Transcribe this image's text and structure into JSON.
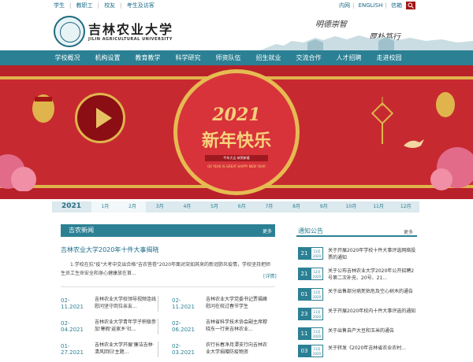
{
  "top": {
    "links": [
      "学生",
      "教职工",
      "校友",
      "考生及访客"
    ],
    "lang": [
      "内网",
      "ENGLISH",
      "信箱"
    ]
  },
  "header": {
    "name_cn": "吉林农业大学",
    "name_en": "JILIN AGRICULTURAL UNIVERSITY",
    "motto1": "明德崇智",
    "motto2": "厚朴笃行"
  },
  "nav": [
    "学校概况",
    "机构设置",
    "教育教学",
    "科学研究",
    "师资队伍",
    "招生就业",
    "交流合作",
    "人才招聘",
    "走进校园"
  ],
  "banner": {
    "year": "2021",
    "title": "新年快乐",
    "sub": "牛年大吉 恭贺新禧",
    "en": "OX YEAR IS GREAT HAPPY NEW YEAR"
  },
  "monthbar": {
    "year": "2021",
    "months": [
      "1月",
      "2月",
      "3月",
      "4月",
      "5月",
      "6月",
      "7月",
      "8月",
      "9月",
      "10月",
      "11月",
      "12月"
    ]
  },
  "news": {
    "heading": "吉农新闻",
    "more": "更多",
    "feature_title": "吉林农业大学2020年十件大事揭晓",
    "feature_body": "1.学校在抗\"疫\"大考中交出合格\"吉农答卷\"2020年面对突如其来的新冠肺炎疫情，学校坚持把师生员工生命安全和身心健康放在首...",
    "feature_detail": "[详情]",
    "items": [
      {
        "date": "02-11.2021",
        "text": "吉林农业大学校领导视频连线慰问坚守岗位亲友..."
      },
      {
        "date": "02-11.2021",
        "text": "吉林农业大学党委书记贾福峰慰问在校过春节学生"
      },
      {
        "date": "02-04.2021",
        "text": "吉林农业大学青年学子积极参加'寒假'返家乡'社..."
      },
      {
        "date": "02-06.2021",
        "text": "吉林省科学技术协会副主席穆晓东一行来吉林农业..."
      },
      {
        "date": "01-27.2021",
        "text": "吉林农业大学开展'廉洁吉林·清风回归'主题..."
      },
      {
        "date": "02-03.2021",
        "text": "农行长春净月潭支行向吉林农业大学捐赠防疫物资"
      }
    ]
  },
  "notice": {
    "heading": "通知公告",
    "more": "更多",
    "items": [
      {
        "day": "21",
        "ym": "12月 2020",
        "text": "关于开展2020年学校十件大事评选网络投票的通知"
      },
      {
        "day": "21",
        "ym": "12月 2020",
        "text": "关于公布吉林农业大学2020年公开招聘2号第二次补充、20号、21..."
      },
      {
        "day": "01",
        "ym": "12月 2020",
        "text": "关于出售部分病死枯危及空心树木的通告"
      },
      {
        "day": "23",
        "ym": "11月 2020",
        "text": "关于开展2020年校内十件大事评选的通知"
      },
      {
        "day": "11",
        "ym": "11月 2020",
        "text": "关于出售自产大豆和玉米的通告"
      },
      {
        "day": "03",
        "ym": "11月 2020",
        "text": "关于转发《2020年吉林省农业农村..."
      }
    ]
  },
  "colors": {
    "teal": "#2b8094",
    "red": "#c62a30",
    "gold": "#e0b44c"
  }
}
